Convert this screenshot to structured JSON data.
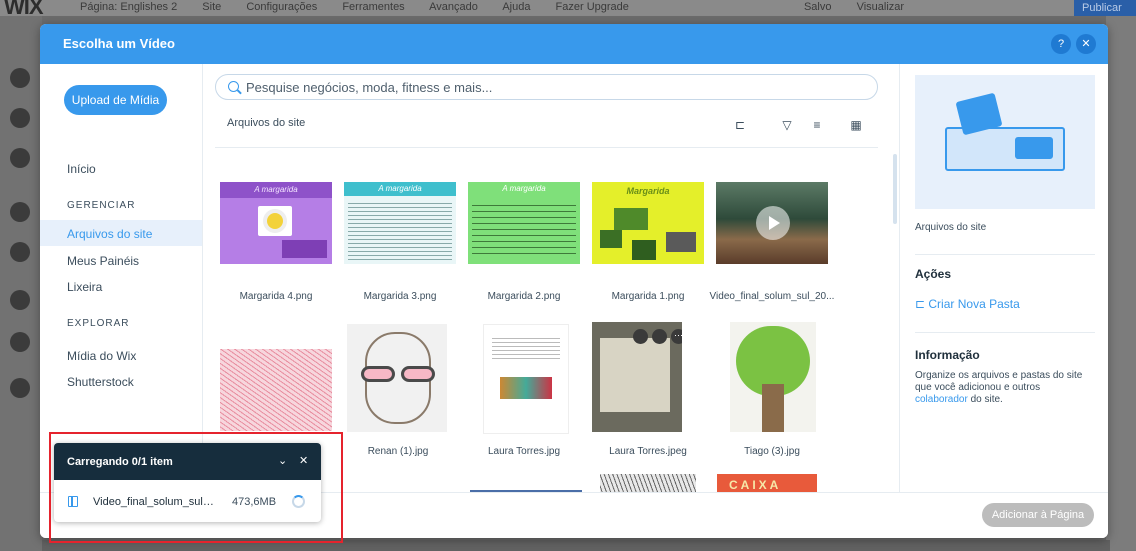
{
  "editor": {
    "logo": "WIX",
    "page_label": "Página: Englishes 2",
    "menu": [
      "Site",
      "Configurações",
      "Ferramentes",
      "Avançado",
      "Ajuda",
      "Fazer Upgrade"
    ],
    "save": "Salvo",
    "preview": "Visualizar",
    "publish": "Publicar"
  },
  "modal": {
    "title": "Escolha um Vídeo",
    "help_icon": "question-icon",
    "close_icon": "close-icon"
  },
  "sidebar": {
    "upload_label": "Upload de Mídia",
    "home": "Início",
    "manage_section": "GERENCIAR",
    "manage_items": [
      "Arquivos do site",
      "Meus Painéis",
      "Lixeira"
    ],
    "explore_section": "EXPLORAR",
    "explore_items": [
      "Mídia do Wix",
      "Shutterstock"
    ]
  },
  "search": {
    "placeholder": "Pesquise negócios, moda, fitness e mais..."
  },
  "main": {
    "folder_label": "Arquivos do site",
    "tools": [
      "new-folder-icon",
      "filter-icon",
      "sort-icon",
      "grid-view-icon"
    ],
    "thumb_heading": "A margarida",
    "thumb_heading_2": "Margarida",
    "row1": [
      "Margarida 4.png",
      "Margarida 3.png",
      "Margarida 2.png",
      "Margarida 1.png",
      "Video_final_solum_sul_20..."
    ],
    "row2": [
      "Renan (1).jpg",
      "Laura Torres.jpg",
      "Laura Torres.jpeg",
      "Tiago (3).jpg"
    ],
    "caixa_text": "CAIXA"
  },
  "pane": {
    "folder_name": "Arquivos do site",
    "actions_heading": "Ações",
    "new_folder": "Criar Nova Pasta",
    "info_heading": "Informação",
    "info_text": "Organize os arquivos e pastas do site que você adicionou e outros",
    "info_link": "colaborador",
    "info_tail": "do site."
  },
  "footer": {
    "add_label": "Adicionar à Página"
  },
  "toast": {
    "title": "Carregando 0/1 item",
    "file": "Video_final_solum_sul_...",
    "size": "473,6MB"
  },
  "colors": {
    "accent": "#3899ec",
    "header": "#3899ec",
    "toast_head": "#162d3d",
    "highlight": "#e5232d"
  }
}
